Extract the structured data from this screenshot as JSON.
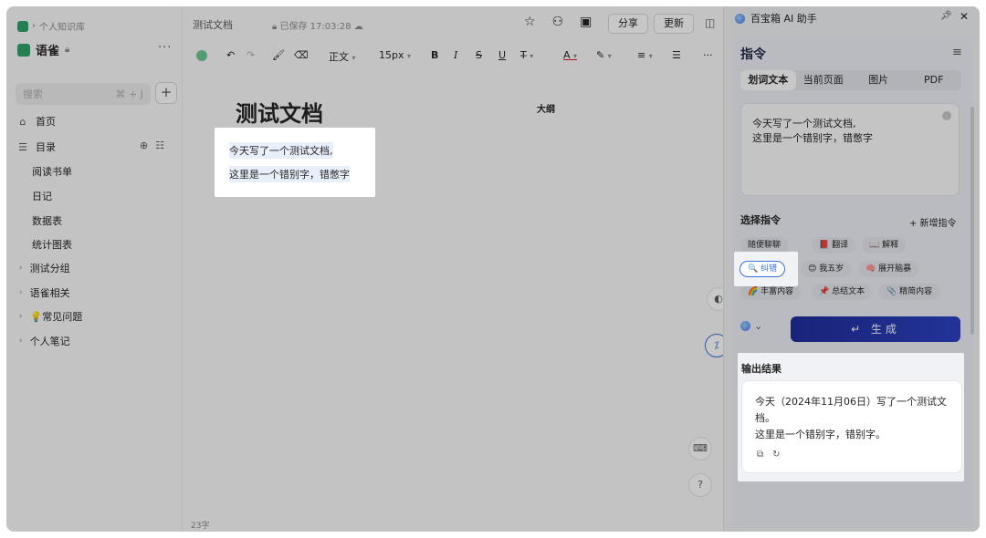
{
  "sidebar": {
    "breadcrumb": "个人知识库",
    "space_title": "语雀",
    "search_placeholder": "搜索",
    "search_shortcut": "⌘ + J",
    "nav": [
      {
        "label": "首页",
        "icon": "home-icon"
      },
      {
        "label": "目录",
        "icon": "toc-icon"
      }
    ],
    "docs": [
      "阅读书单",
      "日记",
      "数据表",
      "统计图表"
    ],
    "groups": [
      "测试分组",
      "语雀相关",
      "💡常见问题",
      "个人笔记"
    ]
  },
  "editor": {
    "doc_name": "测试文档",
    "saved_status": "已保存 17:03:28",
    "share_label": "分享",
    "update_label": "更新",
    "toolbar": {
      "style": "正文",
      "font_size": "15px",
      "bold": "B",
      "italic": "I",
      "strike": "S",
      "underline": "U",
      "more": "···"
    },
    "title": "测试文档",
    "outline_label": "大纲",
    "lines": [
      "今天写了一个测试文档,",
      "这里是一个错别字，错憋字"
    ],
    "word_count": "23字"
  },
  "assistant": {
    "title": "百宝箱 AI 助手",
    "section_title": "指令",
    "tabs": [
      "划词文本",
      "当前页面",
      "图片",
      "PDF"
    ],
    "active_tab": "划词文本",
    "input_lines": [
      "今天写了一个测试文档,",
      "这里是一个错别字，错憋字"
    ],
    "select_label": "选择指令",
    "new_command_label": "+ 新增指令",
    "chips": [
      "随便聊聊",
      "📕 翻译",
      "📖 解释",
      "🔍 纠错",
      "😊 我五岁",
      "🧠 展开脑暴",
      "🌈 丰富内容",
      "📌 总结文本",
      "📎 精简内容"
    ],
    "selected_chip": "🔍 纠错",
    "generate_label": "↵  生成",
    "output_label": "输出结果",
    "output_lines": [
      "今天（2024年11月06日）写了一个测试文",
      "档。",
      "这里是一个错别字，错别字。"
    ],
    "accent_color": "#2d41c2"
  }
}
